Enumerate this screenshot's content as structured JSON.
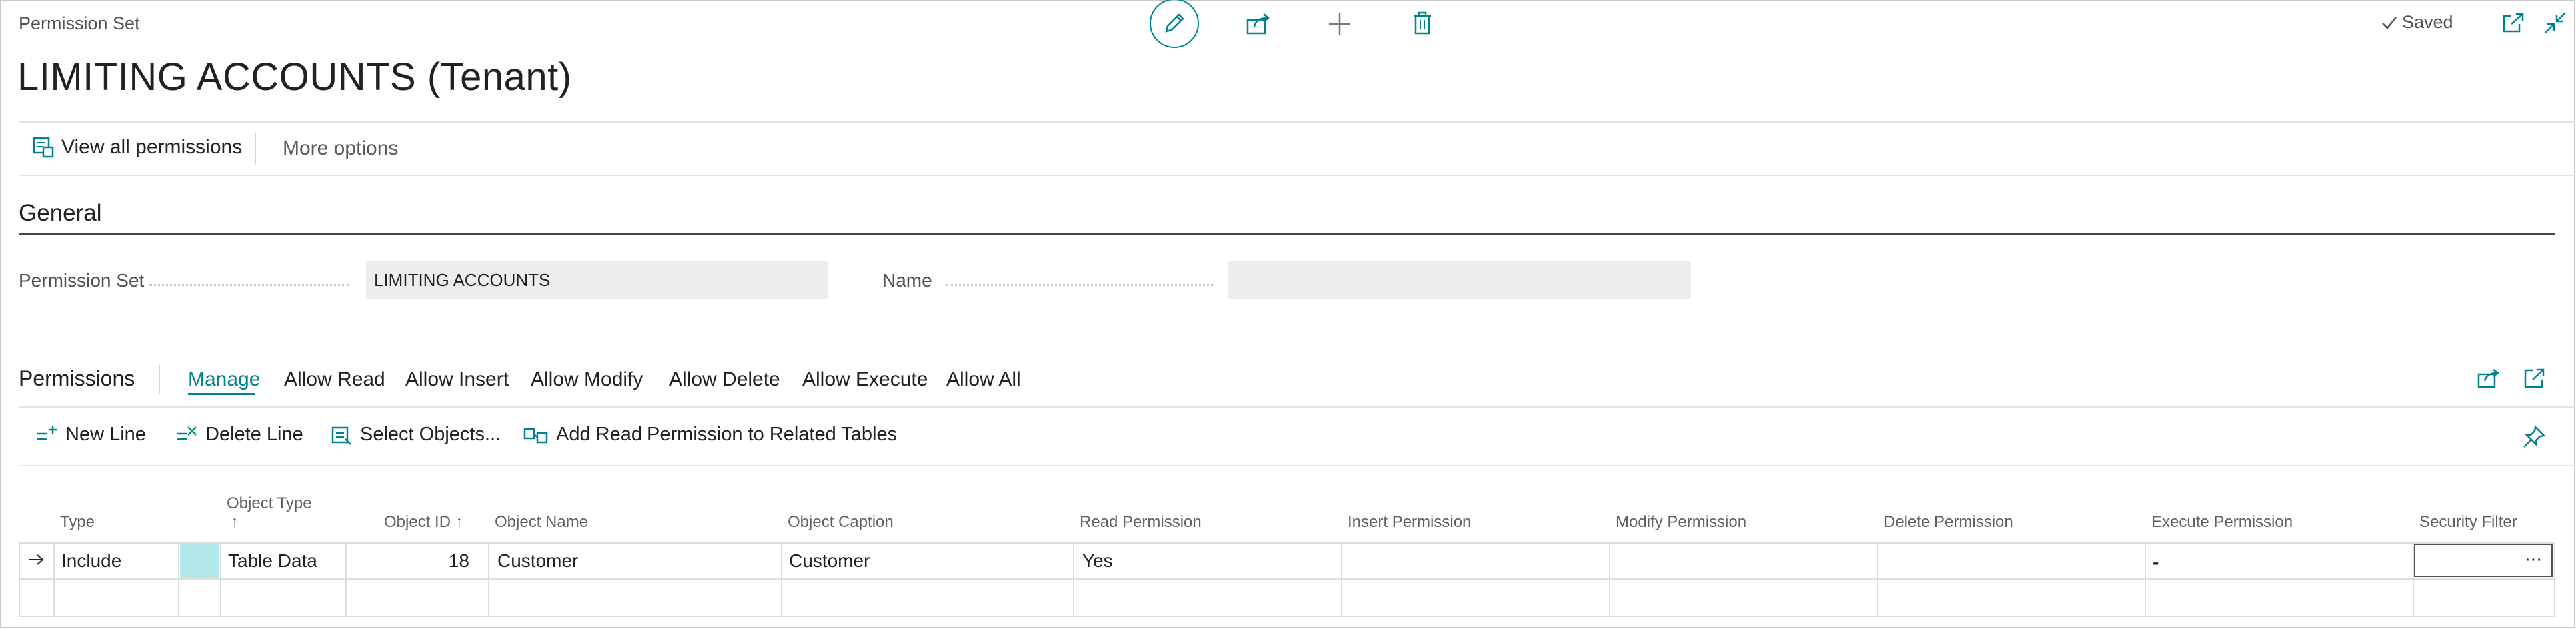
{
  "page": {
    "caption": "Permission Set",
    "title": "LIMITING ACCOUNTS (Tenant)",
    "saved_label": "Saved"
  },
  "toolbar": {
    "view_all": "View all permissions",
    "more_options": "More options"
  },
  "general": {
    "heading": "General",
    "permission_set_label": "Permission Set",
    "permission_set_value": "LIMITING ACCOUNTS",
    "name_label": "Name",
    "name_value": ""
  },
  "permissions": {
    "heading": "Permissions",
    "tabs": [
      "Manage",
      "Allow Read",
      "Allow Insert",
      "Allow Modify",
      "Allow Delete",
      "Allow Execute",
      "Allow All"
    ],
    "actions": {
      "new_line": "New Line",
      "delete_line": "Delete Line",
      "select_objects": "Select Objects...",
      "add_read": "Add Read Permission to Related Tables"
    },
    "columns": {
      "type": "Type",
      "object_type": "Object Type",
      "object_type_sort": "↑",
      "object_id": "Object ID ↑",
      "object_name": "Object Name",
      "object_caption": "Object Caption",
      "read": "Read Permission",
      "insert": "Insert Permission",
      "modify": "Modify Permission",
      "delete": "Delete Permission",
      "execute": "Execute Permission",
      "security_filter": "Security Filter"
    },
    "rows": [
      {
        "type": "Include",
        "object_type": "Table Data",
        "object_id": "18",
        "object_name": "Customer",
        "object_caption": "Customer",
        "read": "Yes",
        "insert": "",
        "modify": "",
        "delete": "",
        "execute": "-",
        "security_filter": ""
      }
    ],
    "accent_color": "#00838f",
    "selected_cell_color": "#b2e8ea"
  }
}
